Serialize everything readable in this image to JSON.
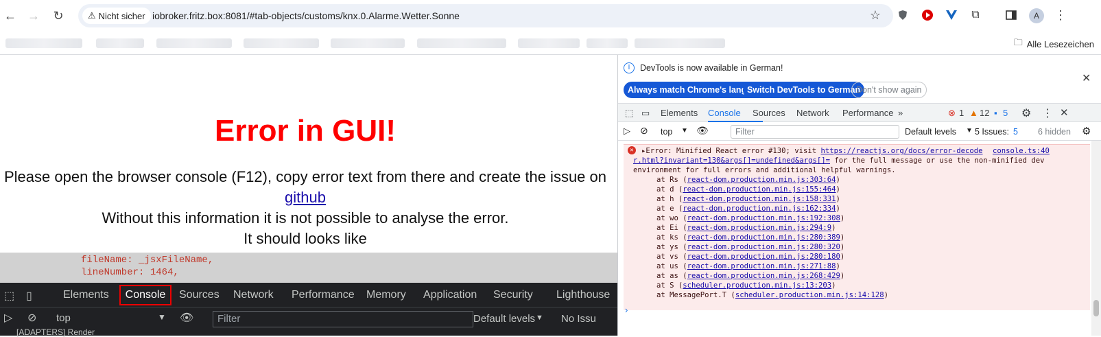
{
  "browser": {
    "not_secure_label": "Nicht sicher",
    "url": "iobroker.fritz.box:8081/#tab-objects/customs/knx.0.Alarme.Wetter.Sonne",
    "all_bookmarks_label": "Alle Lesezeichen",
    "profile_initial": "A"
  },
  "page": {
    "error_title": "Error in GUI!",
    "message_line1": "Please open the browser console (F12), copy error text from there and create the issue on",
    "github_link": "github",
    "message_line2": "Without this information it is not possible to analyse the error.",
    "message_line3": "It should looks like",
    "code_line1": "fileName: _jsxFileName,",
    "code_line2": "lineNumber: 1464,"
  },
  "page_devtools": {
    "tabs": [
      "Elements",
      "Console",
      "Sources",
      "Network",
      "Performance",
      "Memory",
      "Application",
      "Security",
      "Lighthouse"
    ],
    "context": "top",
    "filter_placeholder": "Filter",
    "levels": "Default levels",
    "issues": "No Issu",
    "log_line": "[ADAPTERS] Render"
  },
  "devtools": {
    "info_text": "DevTools is now available in German!",
    "btn_match": "Always match Chrome's language",
    "btn_switch": "Switch DevTools to German",
    "btn_dont_show": "Don't show again",
    "tabs": [
      "Elements",
      "Console",
      "Sources",
      "Network",
      "Performance"
    ],
    "error_count": "1",
    "warning_count": "12",
    "info_count": "5",
    "context": "top",
    "filter_placeholder": "Filter",
    "levels": "Default levels",
    "issues_label": "5 Issues:",
    "issues_count": "5",
    "hidden": "6 hidden",
    "error": {
      "prefix": "Error: Minified React error #130; visit ",
      "link1": "https://reactjs.org/docs/error-decode",
      "source": "console.ts:40",
      "link2": "r.html?invariant=130&args[]=undefined&args[]=",
      "line2_rest": " for the full message or use the non-minified dev",
      "line3": "environment for full errors and additional helpful warnings.",
      "stack": [
        {
          "fn": "at Rs (",
          "loc": "react-dom.production.min.js:303:64"
        },
        {
          "fn": "at d (",
          "loc": "react-dom.production.min.js:155:464"
        },
        {
          "fn": "at h (",
          "loc": "react-dom.production.min.js:158:331"
        },
        {
          "fn": "at e (",
          "loc": "react-dom.production.min.js:162:334"
        },
        {
          "fn": "at wo (",
          "loc": "react-dom.production.min.js:192:308"
        },
        {
          "fn": "at Ei (",
          "loc": "react-dom.production.min.js:294:9"
        },
        {
          "fn": "at ks (",
          "loc": "react-dom.production.min.js:280:389"
        },
        {
          "fn": "at ys (",
          "loc": "react-dom.production.min.js:280:320"
        },
        {
          "fn": "at vs (",
          "loc": "react-dom.production.min.js:280:180"
        },
        {
          "fn": "at us (",
          "loc": "react-dom.production.min.js:271:88"
        },
        {
          "fn": "at as (",
          "loc": "react-dom.production.min.js:268:429"
        },
        {
          "fn": "at S (",
          "loc": "scheduler.production.min.js:13:203"
        },
        {
          "fn": "at MessagePort.T (",
          "loc": "scheduler.production.min.js:14:128"
        }
      ]
    }
  },
  "colors": {
    "error_red": "#ff0000",
    "link_blue": "#1a0dab",
    "devtools_accent": "#1a73e8"
  }
}
